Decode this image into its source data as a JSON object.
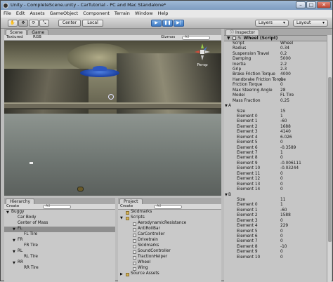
{
  "window": {
    "title": "Unity - CompleteScene.unity - CarTutorial - PC and Mac Standalone*"
  },
  "menu": [
    "File",
    "Edit",
    "Assets",
    "GameObject",
    "Component",
    "Terrain",
    "Window",
    "Help"
  ],
  "toolbar": {
    "center": "Center",
    "local": "Local",
    "layers": "Layers",
    "layout": "Layout"
  },
  "scene": {
    "tabs": [
      "Scene",
      "Game"
    ],
    "render_mode": "Textured",
    "color_mode": "RGB",
    "gizmos": "Gizmos",
    "search_placeholder": "All",
    "persp": "Persp"
  },
  "hierarchy": {
    "tab": "Hierarchy",
    "create": "Create",
    "search_placeholder": "All",
    "items": [
      {
        "label": "Buggy",
        "indent": 0,
        "arrow": "▼",
        "selected": false
      },
      {
        "label": "Car Body",
        "indent": 1,
        "arrow": "",
        "selected": false
      },
      {
        "label": "Center of Mass",
        "indent": 1,
        "arrow": "",
        "selected": false
      },
      {
        "label": "FL",
        "indent": 1,
        "arrow": "▼",
        "selected": true
      },
      {
        "label": "FL Tire",
        "indent": 2,
        "arrow": "",
        "selected": false
      },
      {
        "label": "FR",
        "indent": 1,
        "arrow": "▼",
        "selected": false
      },
      {
        "label": "FR Tire",
        "indent": 2,
        "arrow": "",
        "selected": false
      },
      {
        "label": "RL",
        "indent": 1,
        "arrow": "▼",
        "selected": false
      },
      {
        "label": "RL Tire",
        "indent": 2,
        "arrow": "",
        "selected": false
      },
      {
        "label": "RR",
        "indent": 1,
        "arrow": "▼",
        "selected": false
      },
      {
        "label": "RR Tire",
        "indent": 2,
        "arrow": "",
        "selected": false
      }
    ]
  },
  "project": {
    "tab": "Project",
    "create": "Create",
    "search_placeholder": "All",
    "items": [
      {
        "label": "Skidmarks",
        "indent": 0,
        "type": "folder",
        "arrow": ""
      },
      {
        "label": "Scripts",
        "indent": 0,
        "type": "folder",
        "arrow": "▼"
      },
      {
        "label": "AerodynamicResistance",
        "indent": 1,
        "type": "script",
        "arrow": ""
      },
      {
        "label": "AntiRollBar",
        "indent": 1,
        "type": "script",
        "arrow": ""
      },
      {
        "label": "CarController",
        "indent": 1,
        "type": "script",
        "arrow": ""
      },
      {
        "label": "Drivetrain",
        "indent": 1,
        "type": "script",
        "arrow": ""
      },
      {
        "label": "Skidmarks",
        "indent": 1,
        "type": "script",
        "arrow": ""
      },
      {
        "label": "SoundController",
        "indent": 1,
        "type": "script",
        "arrow": ""
      },
      {
        "label": "TractionHelper",
        "indent": 1,
        "type": "script",
        "arrow": ""
      },
      {
        "label": "Wheel",
        "indent": 1,
        "type": "script",
        "arrow": ""
      },
      {
        "label": "Wing",
        "indent": 1,
        "type": "script",
        "arrow": ""
      },
      {
        "label": "Source Assets",
        "indent": 0,
        "type": "folder",
        "arrow": "▶"
      }
    ]
  },
  "inspector": {
    "tab": "Inspector",
    "component": "Wheel (Script)",
    "rows": [
      {
        "k": "Script",
        "v": "Wheel",
        "indent": 1,
        "arrow": ""
      },
      {
        "k": "Radius",
        "v": "0.34",
        "indent": 1,
        "arrow": ""
      },
      {
        "k": "Suspension Travel",
        "v": "0.2",
        "indent": 1,
        "arrow": ""
      },
      {
        "k": "Damping",
        "v": "5000",
        "indent": 1,
        "arrow": ""
      },
      {
        "k": "Inertia",
        "v": "2.2",
        "indent": 1,
        "arrow": ""
      },
      {
        "k": "Grip",
        "v": "2.3",
        "indent": 1,
        "arrow": ""
      },
      {
        "k": "Brake Friction Torque",
        "v": "4000",
        "indent": 1,
        "arrow": ""
      },
      {
        "k": "Handbrake Friction Torque",
        "v": "0",
        "indent": 1,
        "arrow": ""
      },
      {
        "k": "Friction Torque",
        "v": "0",
        "indent": 1,
        "arrow": ""
      },
      {
        "k": "Max Steering Angle",
        "v": "28",
        "indent": 1,
        "arrow": ""
      },
      {
        "k": "Model",
        "v": "FL Tire",
        "indent": 1,
        "arrow": ""
      },
      {
        "k": "Mass Fraction",
        "v": "0.25",
        "indent": 1,
        "arrow": ""
      },
      {
        "k": "A",
        "v": "",
        "indent": 0,
        "arrow": "▼"
      },
      {
        "k": "Size",
        "v": "15",
        "indent": 2,
        "arrow": ""
      },
      {
        "k": "Element 0",
        "v": "1",
        "indent": 2,
        "arrow": ""
      },
      {
        "k": "Element 1",
        "v": "-60",
        "indent": 2,
        "arrow": ""
      },
      {
        "k": "Element 2",
        "v": "1688",
        "indent": 2,
        "arrow": ""
      },
      {
        "k": "Element 3",
        "v": "4140",
        "indent": 2,
        "arrow": ""
      },
      {
        "k": "Element 4",
        "v": "6.026",
        "indent": 2,
        "arrow": ""
      },
      {
        "k": "Element 5",
        "v": "0",
        "indent": 2,
        "arrow": ""
      },
      {
        "k": "Element 6",
        "v": "-0.3589",
        "indent": 2,
        "arrow": ""
      },
      {
        "k": "Element 7",
        "v": "1",
        "indent": 2,
        "arrow": ""
      },
      {
        "k": "Element 8",
        "v": "0",
        "indent": 2,
        "arrow": ""
      },
      {
        "k": "Element 9",
        "v": "-0.006111",
        "indent": 2,
        "arrow": ""
      },
      {
        "k": "Element 10",
        "v": "-0.03244",
        "indent": 2,
        "arrow": ""
      },
      {
        "k": "Element 11",
        "v": "0",
        "indent": 2,
        "arrow": ""
      },
      {
        "k": "Element 12",
        "v": "0",
        "indent": 2,
        "arrow": ""
      },
      {
        "k": "Element 13",
        "v": "0",
        "indent": 2,
        "arrow": ""
      },
      {
        "k": "Element 14",
        "v": "0",
        "indent": 2,
        "arrow": ""
      },
      {
        "k": "B",
        "v": "",
        "indent": 0,
        "arrow": "▼"
      },
      {
        "k": "Size",
        "v": "11",
        "indent": 2,
        "arrow": ""
      },
      {
        "k": "Element 0",
        "v": "1",
        "indent": 2,
        "arrow": ""
      },
      {
        "k": "Element 1",
        "v": "-60",
        "indent": 2,
        "arrow": ""
      },
      {
        "k": "Element 2",
        "v": "1588",
        "indent": 2,
        "arrow": ""
      },
      {
        "k": "Element 3",
        "v": "0",
        "indent": 2,
        "arrow": ""
      },
      {
        "k": "Element 4",
        "v": "229",
        "indent": 2,
        "arrow": ""
      },
      {
        "k": "Element 5",
        "v": "0",
        "indent": 2,
        "arrow": ""
      },
      {
        "k": "Element 6",
        "v": "0",
        "indent": 2,
        "arrow": ""
      },
      {
        "k": "Element 7",
        "v": "0",
        "indent": 2,
        "arrow": ""
      },
      {
        "k": "Element 8",
        "v": "-10",
        "indent": 2,
        "arrow": ""
      },
      {
        "k": "Element 9",
        "v": "0",
        "indent": 2,
        "arrow": ""
      },
      {
        "k": "Element 10",
        "v": "0",
        "indent": 2,
        "arrow": ""
      }
    ]
  },
  "colors": {
    "selection": "#8e8e8e",
    "play_blue": "#3d79c2",
    "titlebar": "#7e9cc0"
  },
  "icons": [
    "unity-logo-icon",
    "hand-tool-icon",
    "move-tool-icon",
    "rotate-tool-icon",
    "scale-tool-icon",
    "play-icon",
    "pause-icon",
    "step-icon",
    "scene-gizmo-icon"
  ]
}
